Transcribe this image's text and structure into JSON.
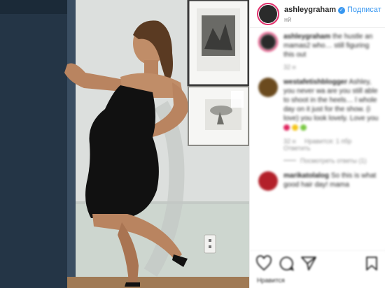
{
  "header": {
    "username": "ashleygraham",
    "follow_label": "Подписат",
    "subtitle": "нй"
  },
  "comments": [
    {
      "username": "ashleygraham",
      "text": "the hustle an mamas2 who… still figuring this out",
      "meta": [
        "32 н"
      ],
      "avatar_color": "#2a2a2a",
      "ring": true
    },
    {
      "username": "westafetishblogger",
      "text": "Ashley, you never wa are you still able to shoot in the heels… l whole day on it just for the show. (i love) you look lovely. Love you",
      "emojis": [
        "#e0245e",
        "#f5c518",
        "#7ac943"
      ],
      "meta": [
        "32 н",
        "Нравится: 1 пбр",
        "Ответить"
      ],
      "replies": "Посмотреть ответы (1)",
      "avatar_color": "#6b4a1e",
      "ring": false
    },
    {
      "username": "marikatolalog",
      "text": "So this is what good hair day! mama",
      "meta": [],
      "avatar_color": "#b3202a",
      "ring": false
    }
  ],
  "actions": {
    "like_icon": "heart-icon",
    "comment_icon": "comment-icon",
    "share_icon": "share-icon",
    "save_icon": "bookmark-icon"
  },
  "likes_text": "Нравится"
}
